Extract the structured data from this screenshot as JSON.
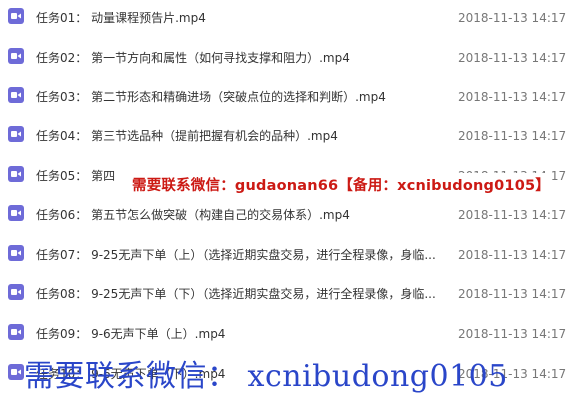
{
  "colors": {
    "icon_bg": "#6e6bd8",
    "overlay_red": "#cc1a14",
    "overlay_blue": "#2a46c9"
  },
  "files": [
    {
      "icon": "video-icon",
      "name": "任务01： 动量课程预告片.mp4",
      "date": "2018-11-13 14:17"
    },
    {
      "icon": "video-icon",
      "name": "任务02： 第一节方向和属性（如何寻找支撑和阻力）.mp4",
      "date": "2018-11-13 14:17"
    },
    {
      "icon": "video-icon",
      "name": "任务03： 第二节形态和精确进场（突破点位的选择和判断）.mp4",
      "date": "2018-11-13 14:17"
    },
    {
      "icon": "video-icon",
      "name": "任务04： 第三节选品种（提前把握有机会的品种）.mp4",
      "date": "2018-11-13 14:17"
    },
    {
      "icon": "video-icon",
      "name": "任务05： 第四",
      "date": "2018-11-13 14:17"
    },
    {
      "icon": "video-icon",
      "name": "任务06： 第五节怎么做突破（构建自己的交易体系）.mp4",
      "date": "2018-11-13 14:17"
    },
    {
      "icon": "video-icon",
      "name": "任务07： 9-25无声下单（上）（选择近期实盘交易，进行全程录像，身临...",
      "date": "2018-11-13 14:17"
    },
    {
      "icon": "video-icon",
      "name": "任务08： 9-25无声下单（下）（选择近期实盘交易，进行全程录像，身临...",
      "date": "2018-11-13 14:17"
    },
    {
      "icon": "video-icon",
      "name": "任务09： 9-6无声下单（上）.mp4",
      "date": "2018-11-13 14:17"
    },
    {
      "icon": "video-icon",
      "name": "任务10： 9-6无声下单（下）.mp4",
      "date": "2018-11-13 14:17"
    }
  ],
  "overlays": {
    "middle": "需要联系微信：gudaonan66【备用：xcnibudong0105】",
    "bottom": "需要联系微信： xcnibudong0105"
  }
}
